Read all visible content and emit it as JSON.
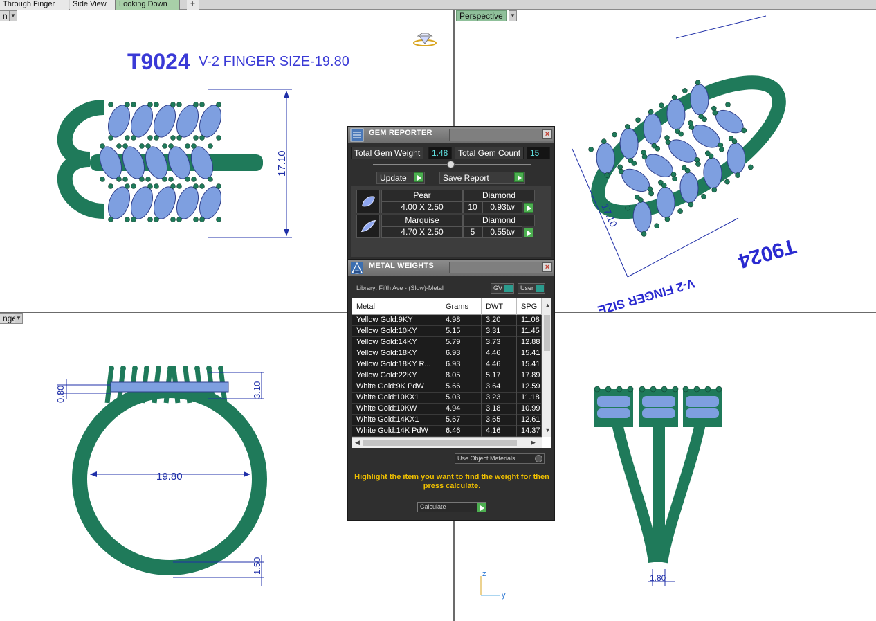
{
  "tabs": {
    "items": [
      {
        "label": "Through Finger"
      },
      {
        "label": "Side View"
      },
      {
        "label": "Looking Down"
      }
    ],
    "add_label": "+"
  },
  "viewports": {
    "top_left": {
      "label": "n"
    },
    "top_right": {
      "label": "Perspective"
    },
    "bottom_left": {
      "label": "nger"
    }
  },
  "drawing": {
    "code": "T9024",
    "subtitle": "V-2 FINGER SIZE-19.80",
    "rotated_code": "T9024",
    "rotated_subtitle": "V-2 FINGER SIZE",
    "dims": {
      "top_height": "17.10",
      "persp_height": "17.10",
      "prong_height": "3.10",
      "band_top": "0.80",
      "inner_diameter": "19.80",
      "band_bottom": "1.50",
      "shank_width": "1.80"
    },
    "axis": {
      "z": "z",
      "y": "y"
    }
  },
  "gem_reporter": {
    "title": "GEM REPORTER",
    "total_weight_label": "Total Gem Weight",
    "total_weight": "1.48",
    "total_count_label": "Total Gem Count",
    "total_count": "15",
    "update_label": "Update",
    "save_label": "Save Report",
    "gems": [
      {
        "shape": "Pear",
        "material": "Diamond",
        "size": "4.00 X 2.50",
        "count": "10",
        "tw": "0.93tw"
      },
      {
        "shape": "Marquise",
        "material": "Diamond",
        "size": "4.70 X 2.50",
        "count": "5",
        "tw": "0.55tw"
      }
    ]
  },
  "metal_weights": {
    "title": "METAL WEIGHTS",
    "library": "Library: Fifth Ave - (Slow)-Metal",
    "gv_label": "GV",
    "user_label": "User",
    "columns": [
      "Metal",
      "Grams",
      "DWT",
      "SPG"
    ],
    "rows": [
      [
        "Yellow Gold:9KY",
        "4.98",
        "3.20",
        "11.08"
      ],
      [
        "Yellow Gold:10KY",
        "5.15",
        "3.31",
        "11.45"
      ],
      [
        "Yellow Gold:14KY",
        "5.79",
        "3.73",
        "12.88"
      ],
      [
        "Yellow Gold:18KY",
        "6.93",
        "4.46",
        "15.41"
      ],
      [
        "Yellow Gold:18KY R...",
        "6.93",
        "4.46",
        "15.41"
      ],
      [
        "Yellow Gold:22KY",
        "8.05",
        "5.17",
        "17.89"
      ],
      [
        "White Gold:9K PdW",
        "5.66",
        "3.64",
        "12.59"
      ],
      [
        "White Gold:10KX1",
        "5.03",
        "3.23",
        "11.18"
      ],
      [
        "White Gold:10KW",
        "4.94",
        "3.18",
        "10.99"
      ],
      [
        "White Gold:14KX1",
        "5.67",
        "3.65",
        "12.61"
      ],
      [
        "White Gold:14K PdW",
        "6.46",
        "4.16",
        "14.37"
      ]
    ],
    "use_object_materials": "Use Object Materials",
    "hint": "Highlight the item you want to find the weight for then press calculate.",
    "calculate_label": "Calculate"
  },
  "colors": {
    "metal": "#1f7a5a",
    "gem": "#7e9fe0",
    "dimension": "#1f2fa8",
    "title": "#3a3ad6",
    "viewport_tab": "#8fc09a"
  }
}
